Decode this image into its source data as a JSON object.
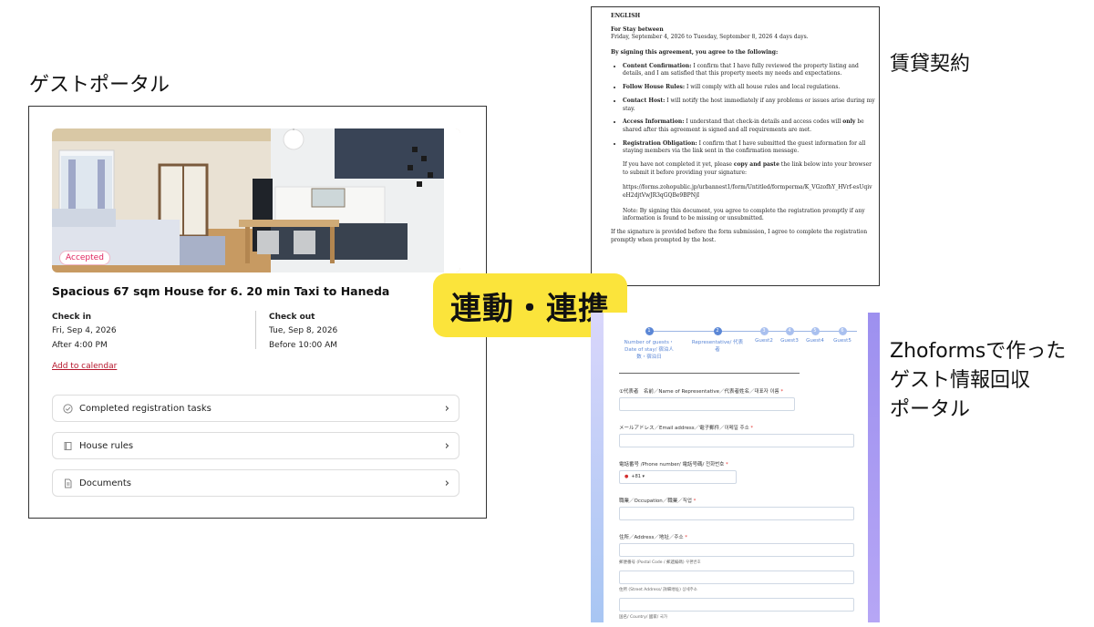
{
  "labels": {
    "guest_portal": "ゲストポータル",
    "lease_contract": "賃貸契約",
    "zoho_line1": "Zhoformsで作った",
    "zoho_line2": "ゲスト情報回収",
    "zoho_line3": "ポータル",
    "link_badge": "連動・連携"
  },
  "portal": {
    "badge": "Accepted",
    "title": "Spacious 67 sqm House for 6. 20 min Taxi to Haneda",
    "checkin": {
      "header": "Check in",
      "date": "Fri, Sep 4, 2026",
      "time": "After 4:00 PM"
    },
    "checkout": {
      "header": "Check out",
      "date": "Tue, Sep 8, 2026",
      "time": "Before 10:00 AM"
    },
    "calendar_link": "Add to calendar",
    "rows": [
      {
        "label": "Completed registration tasks",
        "icon": "check-circle-icon"
      },
      {
        "label": "House rules",
        "icon": "book-icon"
      },
      {
        "label": "Documents",
        "icon": "document-icon"
      }
    ]
  },
  "contract": {
    "lang": "ENGLISH",
    "stay_header": "For Stay between",
    "stay_dates": "Friday, September 4, 2026 to Tuesday, September 8, 2026    4 days days.",
    "agree_header": "By signing this agreement, you agree to the following:",
    "items": [
      {
        "title": "Content Confirmation:",
        "text": " I confirm that I have fully reviewed the property listing and details, and I am satisfied that this property meets my needs and expectations."
      },
      {
        "title": "Follow House Rules:",
        "text": " I will comply with all house rules and local regulations."
      },
      {
        "title": "Contact Host:",
        "text": " I will notify the host immediately if any problems or issues arise during my stay."
      },
      {
        "title": "Access Information:",
        "text_a": " I understand that check-in details and access codes will ",
        "bold": "only",
        "text_b": " be shared after this agreement is signed and all requirements are met."
      },
      {
        "title": "Registration Obligation:",
        "text": " I confirm that I have submitted the guest information for all staying members via the link sent in the confirmation message."
      }
    ],
    "copy_a": "If you have not completed it yet, please ",
    "copy_bold": "copy and paste",
    "copy_b": " the link below into your browser to submit it before providing your signature:",
    "url": "https://forms.zohopublic.jp/urbannest1/form/Untitled/formperma/K_VGzofhY_HVrf-esUqiveH2djtVwJR3qGQBe9BPNjI",
    "note": "Note: By signing this document, you agree to complete the registration promptly if any information is found to be missing or unsubmitted.",
    "footer": "If the signature is provided before the form submission, I agree to complete the registration promptly when prompted by the host."
  },
  "zoho": {
    "steps": [
      {
        "num": "1",
        "line1": "Number of guests・",
        "line2": "Date of stay/ 宿泊人",
        "line3": "数・宿泊日"
      },
      {
        "num": "2",
        "line1": "Representative/ 代表者"
      },
      {
        "num": "3",
        "line1": "Guest2"
      },
      {
        "num": "4",
        "line1": "Guest3"
      },
      {
        "num": "5",
        "line1": "Guest4"
      },
      {
        "num": "6",
        "line1": "Guest5"
      }
    ],
    "fields": {
      "rep_name": "①代表者　名前／Name of Representative／代表者姓名／대표자 이름",
      "email": "メールアドレス／Email address／電子郵件／이메일 주소",
      "phone": "電話番号 /Phone number/ 電話号碼/ 전화번호",
      "phone_value": "+81",
      "occupation": "職業／Occupation／職業／직업",
      "address": "住所／Address／地址／주소",
      "postal": "郵便番号 (Postal Code / 郵遞編碼) 우편번호",
      "street": "住所 (Street Address/ 詳細地址) 상세주소",
      "country": "国名/ Country/ 國家/ 국가"
    },
    "required_mark": "*"
  }
}
